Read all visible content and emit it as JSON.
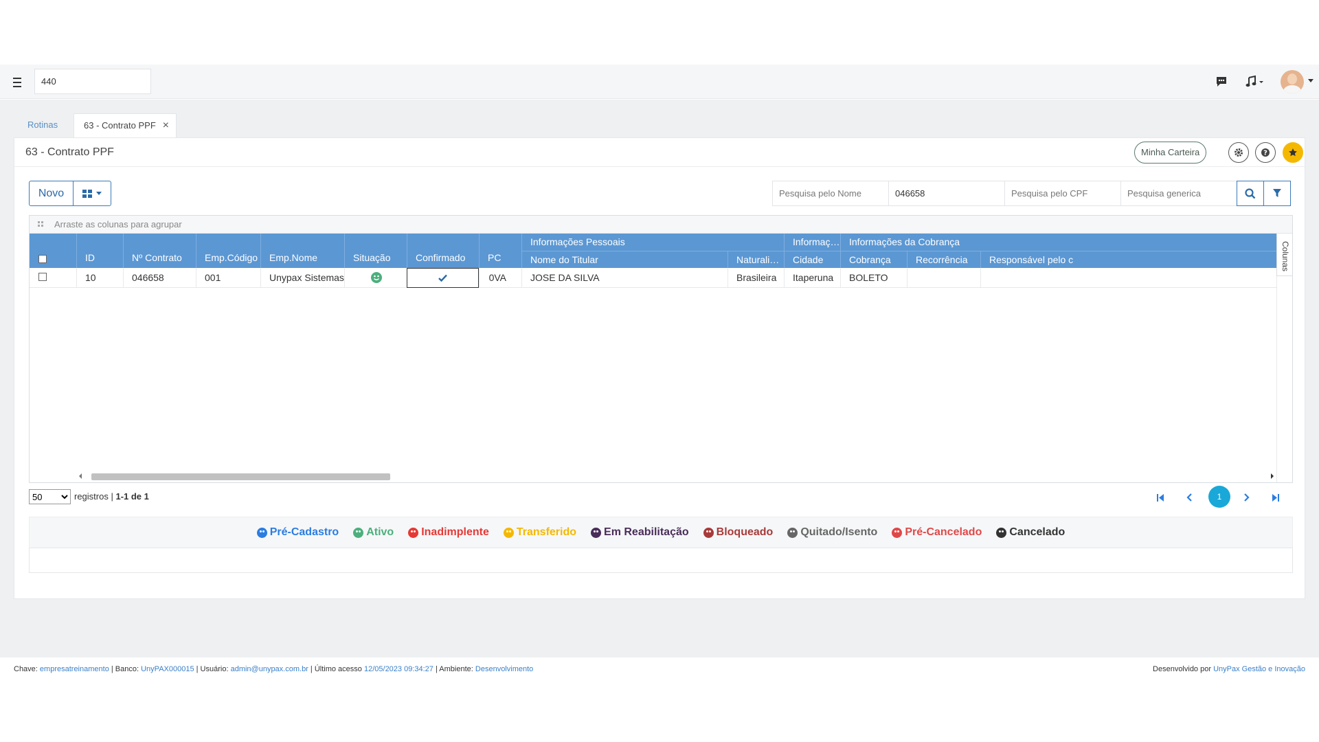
{
  "topbar": {
    "routine_value": "440",
    "icons": [
      "menu-icon",
      "chat-icon",
      "music-icon",
      "avatar"
    ]
  },
  "tabs": [
    {
      "label": "Rotinas"
    },
    {
      "label": "63 - Contrato PPF",
      "close": "×"
    }
  ],
  "panel": {
    "title": "63 - Contrato PPF",
    "minha_carteira": "Minha Carteira",
    "header_icons": [
      "gear-icon",
      "help-icon",
      "star-icon"
    ],
    "accent_color": "#f5b800"
  },
  "toolbar": {
    "novo": "Novo",
    "search_nome_placeholder": "Pesquisa pelo Nome",
    "search_contrato_value": "046658",
    "search_cpf_placeholder": "Pesquisa pelo CPF",
    "search_generica_placeholder": "Pesquisa generica"
  },
  "grid": {
    "group_hint": "Arraste as colunas para agrupar",
    "header_color": "#5b97d3",
    "bands": {
      "pessoais": "Informações Pessoais",
      "informac": "Informaç…",
      "cobranca": "Informações da Cobrança"
    },
    "columns": {
      "id": "ID",
      "contrato": "Nº Contrato",
      "emp_codigo": "Emp.Código",
      "emp_nome": "Emp.Nome",
      "situacao": "Situação",
      "confirmado": "Confirmado",
      "pc": "PC",
      "nome_titular": "Nome do Titular",
      "naturalidade": "Naturali…",
      "cidade": "Cidade",
      "cobranca": "Cobrança",
      "recorrencia": "Recorrência",
      "responsavel": "Responsável pelo c"
    },
    "colunas_tab": "Colunas",
    "rows": [
      {
        "id": "10",
        "contrato": "046658",
        "emp_codigo": "001",
        "emp_nome": "Unypax Sistemas",
        "situacao_icon": "smile-icon",
        "situacao_color": "#4caf7d",
        "confirmado_icon": "check-icon",
        "pc": "0VA",
        "nome_titular": "JOSE DA SILVA",
        "naturalidade": "Brasileira",
        "cidade": "Itaperuna",
        "cobranca": "BOLETO",
        "recorrencia": "",
        "responsavel": ""
      }
    ]
  },
  "pager": {
    "page_size": "50",
    "registros": "registros",
    "range": "1-1 de 1",
    "current_page": "1",
    "current_color": "#19a8d8"
  },
  "legend": [
    {
      "label": "Pré-Cadastro",
      "color": "#2a7de1"
    },
    {
      "label": "Ativo",
      "color": "#4caf7d"
    },
    {
      "label": "Inadimplente",
      "color": "#e53935"
    },
    {
      "label": "Transferido",
      "color": "#f5b800"
    },
    {
      "label": "Em Reabilitação",
      "color": "#4a2d5a"
    },
    {
      "label": "Bloqueado",
      "color": "#a83a3a"
    },
    {
      "label": "Quitado/Isento",
      "color": "#666666"
    },
    {
      "label": "Pré-Cancelado",
      "color": "#e04848"
    },
    {
      "label": "Cancelado",
      "color": "#333333"
    }
  ],
  "footer": {
    "chave_label": "Chave:",
    "chave": "empresatreinamento",
    "banco_label": "| Banco:",
    "banco": "UnyPAX000015",
    "usuario_label": "| Usuário:",
    "usuario": "admin@unypax.com.br",
    "acesso_label": "| Último acesso",
    "acesso": "12/05/2023 09:34:27",
    "ambiente_label": "| Ambiente:",
    "ambiente": "Desenvolvimento",
    "dev_label": "Desenvolvido por",
    "dev": "UnyPax Gestão e Inovação"
  }
}
